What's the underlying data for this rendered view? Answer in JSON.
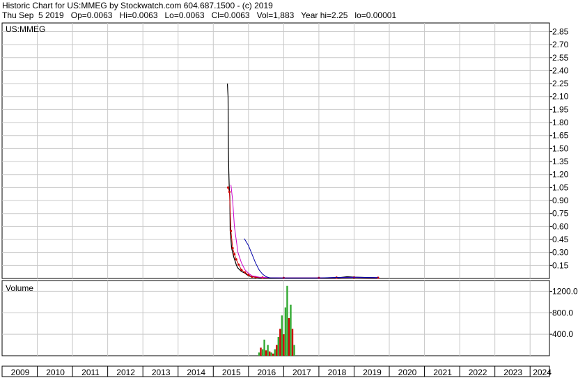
{
  "header": {
    "title": "Historic Chart for US:MMEG by Stockwatch.com 604.687.1500 - (c) 2019",
    "quote": "Thu Sep  5 2019   Op=0.0063   Hi=0.0063   Lo=0.0063   Cl=0.0063   Vol=1,883   Year hi=2.25   lo=0.00001"
  },
  "colors": {
    "price": "#000000",
    "ma_short": "#cc0000",
    "ma_mid": "#cc00cc",
    "ma_long": "#0000aa",
    "volume_up": "#33aa33",
    "volume_down": "#cc0000",
    "grid": "#c8c8c8"
  },
  "chart_data": [
    {
      "type": "line",
      "title": "US:MMEG",
      "x_unit": "year",
      "ylim": [
        0,
        2.95
      ],
      "y_ticks": [
        "2.85",
        "2.70",
        "2.55",
        "2.40",
        "2.25",
        "2.10",
        "1.95",
        "1.80",
        "1.65",
        "1.50",
        "1.35",
        "1.20",
        "1.05",
        "0.90",
        "0.75",
        "0.60",
        "0.45",
        "0.30",
        "0.15"
      ],
      "x_ticks": [
        "2009",
        "2010",
        "2011",
        "2012",
        "2013",
        "2014",
        "2015",
        "2016",
        "2017",
        "2018",
        "2019",
        "2020",
        "2021",
        "2022",
        "2023",
        "2024"
      ],
      "grid": true,
      "series": [
        {
          "role": "price",
          "x": [
            2015.4,
            2015.42,
            2015.43,
            2015.44,
            2015.45,
            2015.46,
            2015.47,
            2015.48,
            2015.5,
            2015.52,
            2015.55,
            2015.58,
            2015.62,
            2015.66,
            2015.7,
            2015.75,
            2015.8,
            2015.9,
            2016.0,
            2016.1,
            2016.3,
            2016.6,
            2017.0,
            2017.5,
            2018.0,
            2018.5,
            2018.8,
            2019.0,
            2019.5,
            2019.68
          ],
          "y": [
            2.25,
            2.1,
            1.5,
            1.25,
            1.1,
            1.0,
            0.95,
            0.55,
            0.45,
            0.35,
            0.3,
            0.25,
            0.2,
            0.15,
            0.12,
            0.1,
            0.08,
            0.06,
            0.03,
            0.02,
            0.01,
            0.005,
            0.005,
            0.005,
            0.005,
            0.006,
            0.02,
            0.015,
            0.01,
            0.0063
          ]
        },
        {
          "role": "moving-average-short",
          "x": [
            2015.42,
            2015.46,
            2015.5,
            2015.55,
            2015.6,
            2015.65,
            2015.72,
            2015.8,
            2015.9,
            2016.0,
            2016.1,
            2016.2,
            2016.4,
            2017.0,
            2018.0,
            2018.5,
            2019.0,
            2019.68
          ],
          "y": [
            1.05,
            1.0,
            0.55,
            0.35,
            0.28,
            0.22,
            0.16,
            0.1,
            0.07,
            0.04,
            0.02,
            0.015,
            0.01,
            0.006,
            0.006,
            0.01,
            0.012,
            0.008
          ]
        },
        {
          "role": "moving-average-mid",
          "x": [
            2015.5,
            2015.55,
            2015.6,
            2015.7,
            2015.8,
            2015.9,
            2016.0,
            2016.1,
            2016.3,
            2016.6,
            2017.0,
            2018.0,
            2018.5,
            2019.0,
            2019.68
          ],
          "y": [
            1.08,
            0.9,
            0.6,
            0.3,
            0.18,
            0.1,
            0.06,
            0.03,
            0.015,
            0.008,
            0.006,
            0.006,
            0.01,
            0.012,
            0.009
          ]
        },
        {
          "role": "moving-average-long",
          "x": [
            2015.88,
            2016.0,
            2016.1,
            2016.2,
            2016.3,
            2016.4,
            2016.5,
            2016.6,
            2017.0,
            2018.0,
            2018.5,
            2019.0,
            2019.68
          ],
          "y": [
            0.46,
            0.38,
            0.28,
            0.18,
            0.1,
            0.05,
            0.02,
            0.008,
            0.006,
            0.006,
            0.012,
            0.014,
            0.01
          ]
        }
      ]
    },
    {
      "type": "bar",
      "title": "Volume",
      "ylim": [
        0,
        1400
      ],
      "y_ticks": [
        "1200.0",
        "800.0",
        "400.0"
      ],
      "series": [
        {
          "name": "Volume",
          "x": [
            2016.3,
            2016.35,
            2016.4,
            2016.45,
            2016.5,
            2016.55,
            2016.6,
            2016.65,
            2016.7,
            2016.75,
            2016.8,
            2016.85,
            2016.9,
            2016.95,
            2017.0,
            2017.05,
            2017.1,
            2017.15,
            2017.2,
            2017.25,
            2017.3
          ],
          "values": [
            60,
            150,
            120,
            300,
            100,
            200,
            80,
            60,
            40,
            120,
            200,
            350,
            500,
            750,
            400,
            900,
            1300,
            700,
            950,
            500,
            200
          ],
          "direction": [
            "up",
            "down",
            "up",
            "up",
            "down",
            "up",
            "down",
            "up",
            "down",
            "up",
            "down",
            "up",
            "down",
            "up",
            "down",
            "up",
            "up",
            "down",
            "up",
            "down",
            "up"
          ]
        }
      ]
    }
  ]
}
